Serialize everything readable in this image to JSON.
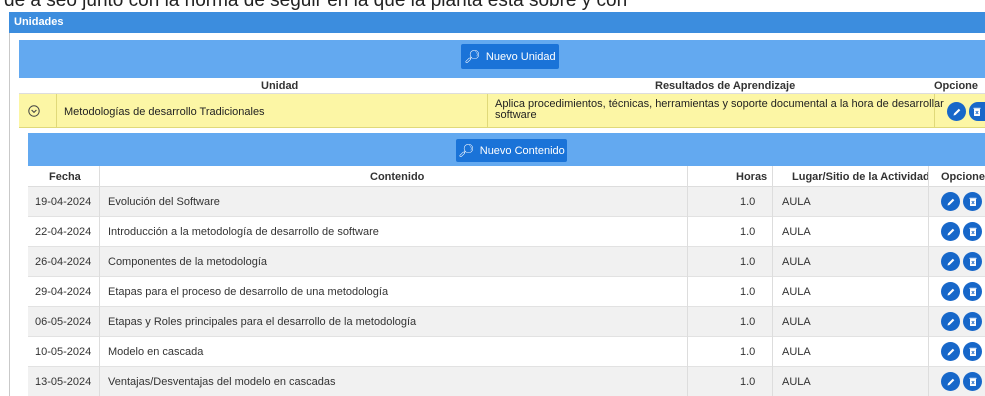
{
  "top_text": "de a seo junto con la norma de seguir en la que la planta esta sobre y con",
  "panel": {
    "title": "Unidades"
  },
  "units_section": {
    "new_button_label": "Nuevo Unidad",
    "columns": {
      "unit": "Unidad",
      "results": "Resultados de Aprendizaje",
      "options": "Opcione"
    },
    "row": {
      "unit": "Metodologías de desarrollo Tradicionales",
      "results_line1": "Aplica procedimientos, técnicas, herramientas y soporte documental a la hora de desarrollar",
      "results_line2": "software"
    }
  },
  "content_section": {
    "new_button_label": "Nuevo Contenido",
    "columns": {
      "date": "Fecha",
      "content": "Contenido",
      "hours": "Horas",
      "place": "Lugar/Sitio de la Actividad",
      "options": "Opciones"
    },
    "rows": [
      {
        "date": "19-04-2024",
        "content": "Evolución del Software",
        "hours": "1.0",
        "place": "AULA"
      },
      {
        "date": "22-04-2024",
        "content": "Introducción a la metodología de desarrollo de software",
        "hours": "1.0",
        "place": "AULA"
      },
      {
        "date": "26-04-2024",
        "content": "Componentes de la metodología",
        "hours": "1.0",
        "place": "AULA"
      },
      {
        "date": "29-04-2024",
        "content": "Etapas para el proceso de desarrollo de una metodología",
        "hours": "1.0",
        "place": "AULA"
      },
      {
        "date": "06-05-2024",
        "content": "Etapas y Roles principales para el desarrollo de la metodología",
        "hours": "1.0",
        "place": "AULA"
      },
      {
        "date": "10-05-2024",
        "content": "Modelo en cascada",
        "hours": "1.0",
        "place": "AULA"
      },
      {
        "date": "13-05-2024",
        "content": "Ventajas/Desventajas del modelo en cascadas",
        "hours": "1.0",
        "place": "AULA"
      }
    ]
  },
  "icons": {
    "edit": "pencil-icon",
    "delete": "trash-icon",
    "search": "search-icon",
    "expand": "chevron-down-circle-icon"
  },
  "colors": {
    "header": "#3c8dde",
    "bar": "#63a9f0",
    "button": "#1a73d8",
    "highlight_row": "#fcf6a5",
    "icon_button": "#1767c9"
  }
}
